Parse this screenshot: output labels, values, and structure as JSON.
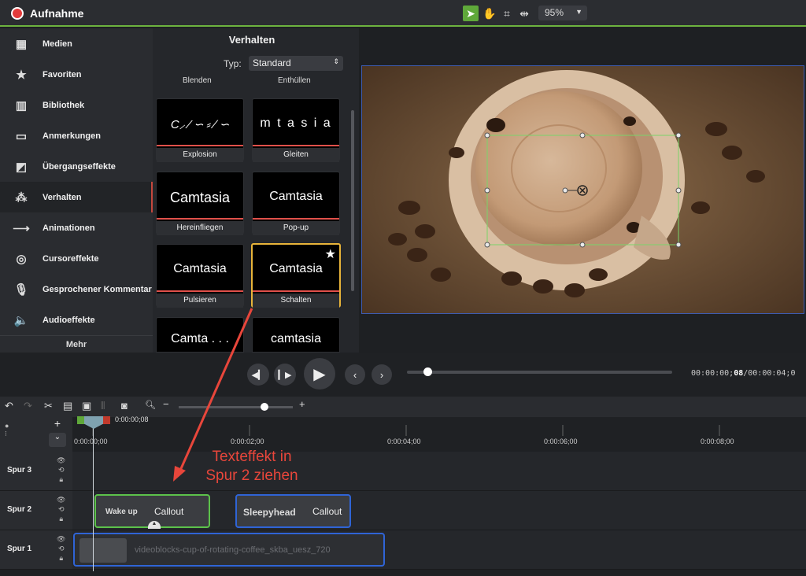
{
  "header": {
    "title": "Aufnahme",
    "zoom": "95%"
  },
  "sidebar": {
    "items": [
      {
        "label": "Medien",
        "icon": "film-icon"
      },
      {
        "label": "Favoriten",
        "icon": "star-icon"
      },
      {
        "label": "Bibliothek",
        "icon": "library-icon"
      },
      {
        "label": "Anmerkungen",
        "icon": "annotation-icon"
      },
      {
        "label": "Übergangseffekte",
        "icon": "transition-icon"
      },
      {
        "label": "Verhalten",
        "icon": "behavior-icon"
      },
      {
        "label": "Animationen",
        "icon": "animation-icon"
      },
      {
        "label": "Cursoreffekte",
        "icon": "cursor-icon"
      },
      {
        "label": "Gesprochener Kommentar",
        "icon": "microphone-icon"
      },
      {
        "label": "Audioeffekte",
        "icon": "speaker-icon"
      }
    ],
    "more": "Mehr"
  },
  "behaviors": {
    "title": "Verhalten",
    "type_label": "Typ:",
    "type_value": "Standard",
    "top_labels": [
      "Blenden",
      "Enthüllen"
    ],
    "thumbs": [
      {
        "preview": "C⸝ ⁄ ∽ ⸗ ∕ ∽",
        "label": "Explosion"
      },
      {
        "preview": "m  t a s i a",
        "label": "Gleiten"
      },
      {
        "preview": "Camtasia",
        "label": "Hereinfliegen"
      },
      {
        "preview": "Camtasia",
        "label": "Pop-up"
      },
      {
        "preview": "Camtasia",
        "label": "Pulsieren"
      },
      {
        "preview": "Camtasia",
        "label": "Schalten"
      },
      {
        "preview": "Camta . . .",
        "label": ""
      },
      {
        "preview": "camtasia",
        "label": ""
      }
    ]
  },
  "playback": {
    "timecode_pre": "00:00:00;",
    "timecode_bold": "08",
    "timecode_post": "/00:00:04;0"
  },
  "timeline": {
    "playhead_time": "0:00:00;08",
    "ticks": [
      "0:00:00;00",
      "0:00:02;00",
      "0:00:04;00",
      "0:00:06;00",
      "0:00:08;00"
    ],
    "tracks": [
      "Spur 3",
      "Spur 2",
      "Spur 1"
    ],
    "clips": {
      "callout1_text": "Wake up",
      "callout1_type": "Callout",
      "callout2_text": "Sleepyhead",
      "callout2_type": "Callout",
      "video_name": "videoblocks-cup-of-rotating-coffee_skba_uesz_720"
    }
  },
  "annotation": {
    "line1": "Texteffekt in",
    "line2": "Spur 2 ziehen"
  },
  "colors": {
    "accent_green": "#6db33f",
    "record_red": "#e23b3b",
    "selection_yellow": "#e8b43a",
    "clip_green": "#5cc24a",
    "clip_blue": "#2f64d6",
    "annotation_red": "#e8463b"
  }
}
